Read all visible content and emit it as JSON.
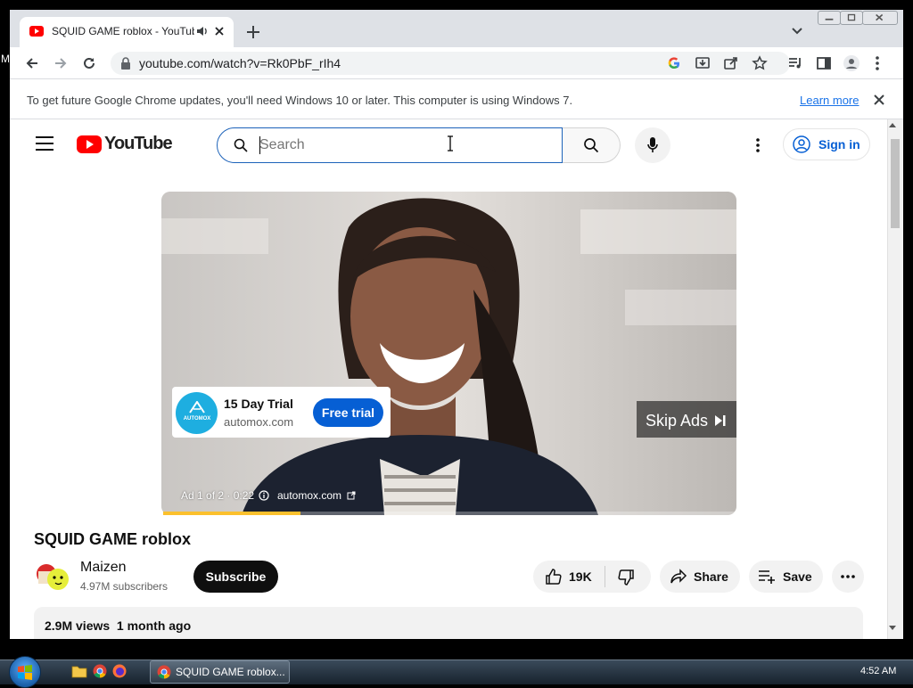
{
  "desktop": {
    "edge_letter": "M"
  },
  "browser": {
    "tab_title": "SQUID GAME roblox - YouTube",
    "url": "youtube.com/watch?v=Rk0PbF_rIh4",
    "infobar_text": "To get future Google Chrome updates, you'll need Windows 10 or later. This computer is using Windows 7.",
    "infobar_link": "Learn more"
  },
  "youtube": {
    "logo_text": "YouTube",
    "search_placeholder": "Search",
    "signin_label": "Sign in"
  },
  "ad": {
    "card_title": "15 Day Trial",
    "card_domain": "automox.com",
    "logo_text": "AUTOMOX",
    "cta_label": "Free trial",
    "skip_label": "Skip Ads",
    "info_text": "Ad 1 of 2 · 0:22",
    "info_domain": "automox.com",
    "progress_fraction": 0.24
  },
  "video": {
    "title": "SQUID GAME roblox",
    "channel_name": "Maizen",
    "subscribers": "4.97M subscribers",
    "subscribe_label": "Subscribe",
    "like_count": "19K",
    "share_label": "Share",
    "save_label": "Save",
    "views_line": "2.9M views  1 month ago"
  },
  "taskbar": {
    "task_label": "SQUID GAME roblox...",
    "clock": "4:52 AM"
  },
  "colors": {
    "youtube_red": "#ff0000",
    "link_blue": "#065fd4",
    "ad_blue": "#1eaee0",
    "progress_yellow": "#fbc02d"
  }
}
